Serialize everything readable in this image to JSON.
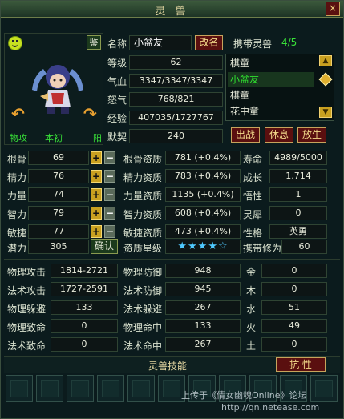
{
  "window": {
    "title": "灵 兽",
    "close_glyph": "×"
  },
  "portrait": {
    "appraise_label": "鉴",
    "tags": [
      "物攻",
      "本初",
      "阳"
    ]
  },
  "basic": {
    "name_label": "名称",
    "name_value": "小盆友",
    "rename_label": "改名",
    "level_label": "等级",
    "level_value": "62",
    "hp_label": "气血",
    "hp_value": "3347/3347/3347",
    "rage_label": "怒气",
    "rage_value": "768/821",
    "exp_label": "经验",
    "exp_value": "407035/1727767",
    "tacit_label": "默契",
    "tacit_value": "240"
  },
  "carry": {
    "label": "携带灵兽",
    "count": "4/5",
    "pets": [
      {
        "name": "棋童",
        "selected": false
      },
      {
        "name": "小盆友",
        "selected": true
      },
      {
        "name": "棋童",
        "selected": false
      },
      {
        "name": "花中童",
        "selected": false
      }
    ],
    "actions": [
      "出战",
      "休息",
      "放生"
    ]
  },
  "attrs": [
    {
      "label": "根骨",
      "value": "69",
      "apt_label": "根骨资质",
      "apt_value": "781 (+0.4%)",
      "r_label": "寿命",
      "r_value": "4989/5000"
    },
    {
      "label": "精力",
      "value": "76",
      "apt_label": "精力资质",
      "apt_value": "783 (+0.4%)",
      "r_label": "成长",
      "r_value": "1.714"
    },
    {
      "label": "力量",
      "value": "74",
      "apt_label": "力量资质",
      "apt_value": "1135 (+0.4%)",
      "r_label": "悟性",
      "r_value": "1"
    },
    {
      "label": "智力",
      "value": "79",
      "apt_label": "智力资质",
      "apt_value": "608 (+0.4%)",
      "r_label": "灵犀",
      "r_value": "0"
    },
    {
      "label": "敏捷",
      "value": "77",
      "apt_label": "敏捷资质",
      "apt_value": "473 (+0.4%)",
      "r_label": "性格",
      "r_value": "英勇"
    }
  ],
  "potential": {
    "label": "潜力",
    "value": "305",
    "confirm_label": "确认",
    "stars_label": "资质星级",
    "stars": "★★★★☆",
    "star_count": 4,
    "cult_label": "携带修为",
    "cult_value": "60"
  },
  "combat": [
    {
      "l1": "物理攻击",
      "v1": "1814-2721",
      "l2": "物理防御",
      "v2": "948",
      "l3": "金",
      "v3": "0"
    },
    {
      "l1": "法术攻击",
      "v1": "1727-2591",
      "l2": "法术防御",
      "v2": "945",
      "l3": "木",
      "v3": "0"
    },
    {
      "l1": "物理躲避",
      "v1": "133",
      "l2": "法术躲避",
      "v2": "267",
      "l3": "水",
      "v3": "51"
    },
    {
      "l1": "物理致命",
      "v1": "0",
      "l2": "物理命中",
      "v2": "133",
      "l3": "火",
      "v3": "49"
    },
    {
      "l1": "法术致命",
      "v1": "0",
      "l2": "法术命中",
      "v2": "267",
      "l3": "土",
      "v3": "0"
    }
  ],
  "skills": {
    "label": "灵兽技能",
    "resist_label": "抗 性",
    "slot_count": 11
  },
  "watermark": {
    "line1": "上传于《倩女幽魂Online》论坛",
    "line2": "http://qn.netease.com"
  },
  "colors": {
    "accent_red": "#5a0f0f",
    "gold": "#c6a45c",
    "selected_green": "#2fe02f"
  }
}
